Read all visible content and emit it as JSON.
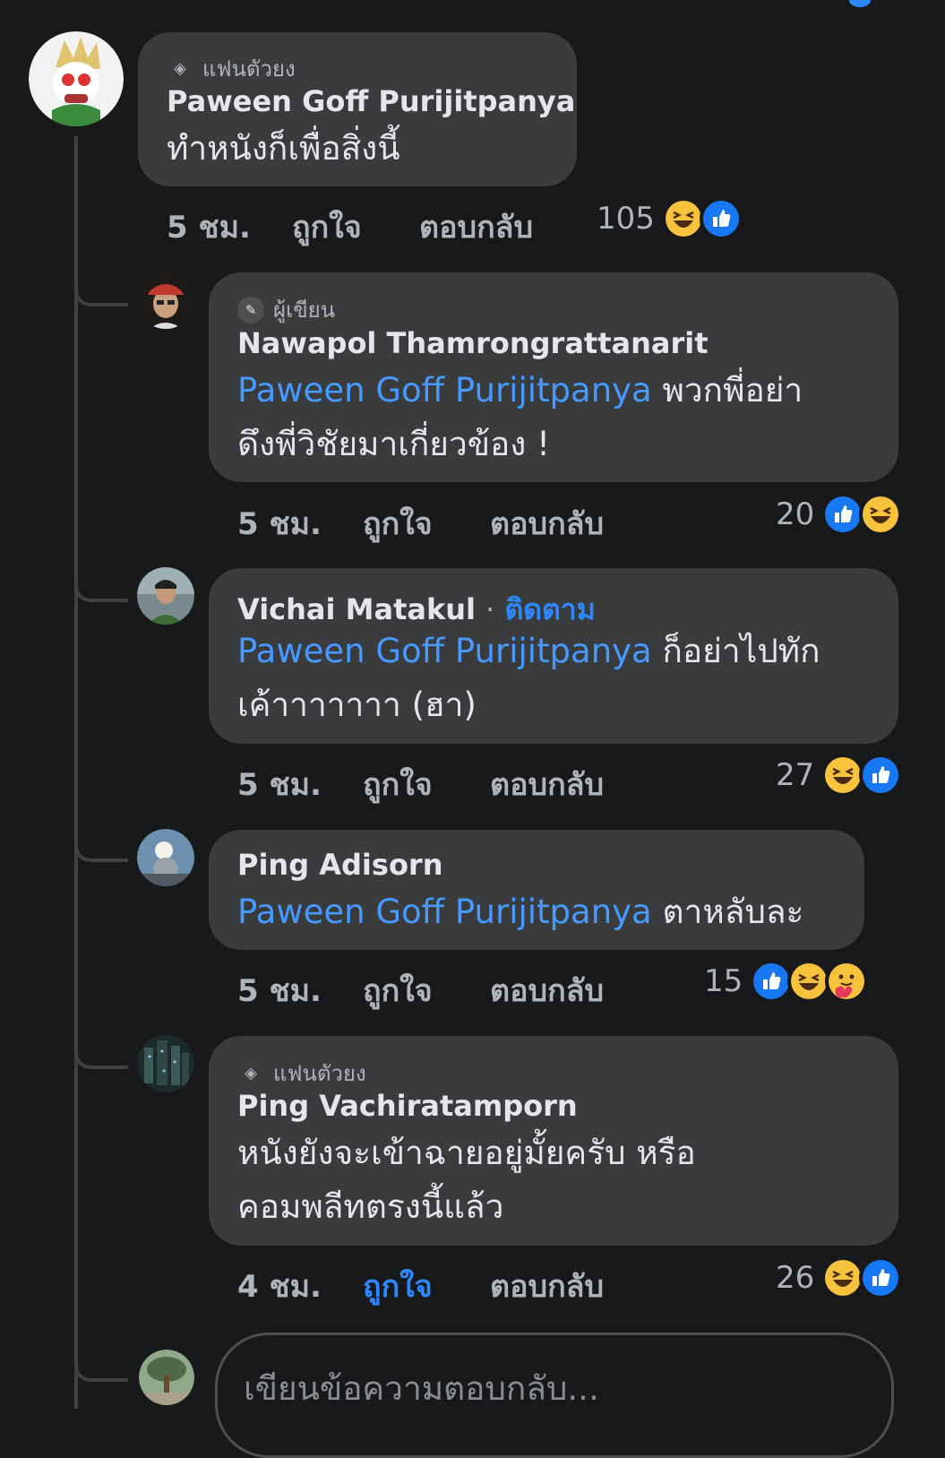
{
  "parent": {
    "badge": "แฟนตัวยง",
    "name": "Paween Goff Purijitpanya",
    "text": "ทำหนังก็เพื่อสิ่งนี้",
    "time": "5 ชม.",
    "like": "ถูกใจ",
    "reply": "ตอบกลับ",
    "count": "105",
    "reactions": [
      "haha",
      "like"
    ]
  },
  "replies": [
    {
      "badge": "ผู้เขียน",
      "badge_icon": "pencil-icon",
      "name": "Nawapol Thamrongrattanarit",
      "mention": "Paween Goff Purijitpanya",
      "text_line1": " พวกพี่อย่า",
      "text_line2": "ดึงพี่วิชัยมาเกี่ยวข้อง !",
      "time": "5 ชม.",
      "like": "ถูกใจ",
      "reply": "ตอบกลับ",
      "count": "20",
      "reactions": [
        "like",
        "haha"
      ]
    },
    {
      "name": "Vichai Matakul",
      "separator": "·",
      "follow": "ติดตาม",
      "mention": "Paween Goff Purijitpanya",
      "text_line1": " ก็อย่าไปทัก",
      "text_line2": "เค้าาาาาาา (ฮา)",
      "time": "5 ชม.",
      "like": "ถูกใจ",
      "reply": "ตอบกลับ",
      "count": "27",
      "reactions": [
        "haha",
        "like"
      ]
    },
    {
      "name": "Ping Adisorn",
      "mention": "Paween Goff Purijitpanya",
      "text_line1": " ตาหลับละ",
      "time": "5 ชม.",
      "like": "ถูกใจ",
      "reply": "ตอบกลับ",
      "count": "15",
      "reactions": [
        "like",
        "haha",
        "care"
      ]
    },
    {
      "badge": "แฟนตัวยง",
      "badge_icon": "diamond-icon",
      "name": "Ping Vachiratamporn",
      "text_line1": "หนังยังจะเข้าฉายอยู่มั้ยครับ หรือ",
      "text_line2": "คอมพลีทตรงนี้แล้ว",
      "time": "4 ชม.",
      "like": "ถูกใจ",
      "like_active": true,
      "reply": "ตอบกลับ",
      "count": "26",
      "reactions": [
        "haha",
        "like"
      ]
    }
  ],
  "composer": {
    "placeholder": "เขียนข้อความตอบกลับ..."
  },
  "colors": {
    "background": "#18191a",
    "bubble": "#3a3b3c",
    "accent": "#2d88ff",
    "mention": "#4599ff",
    "meta": "#b0b3b8"
  }
}
